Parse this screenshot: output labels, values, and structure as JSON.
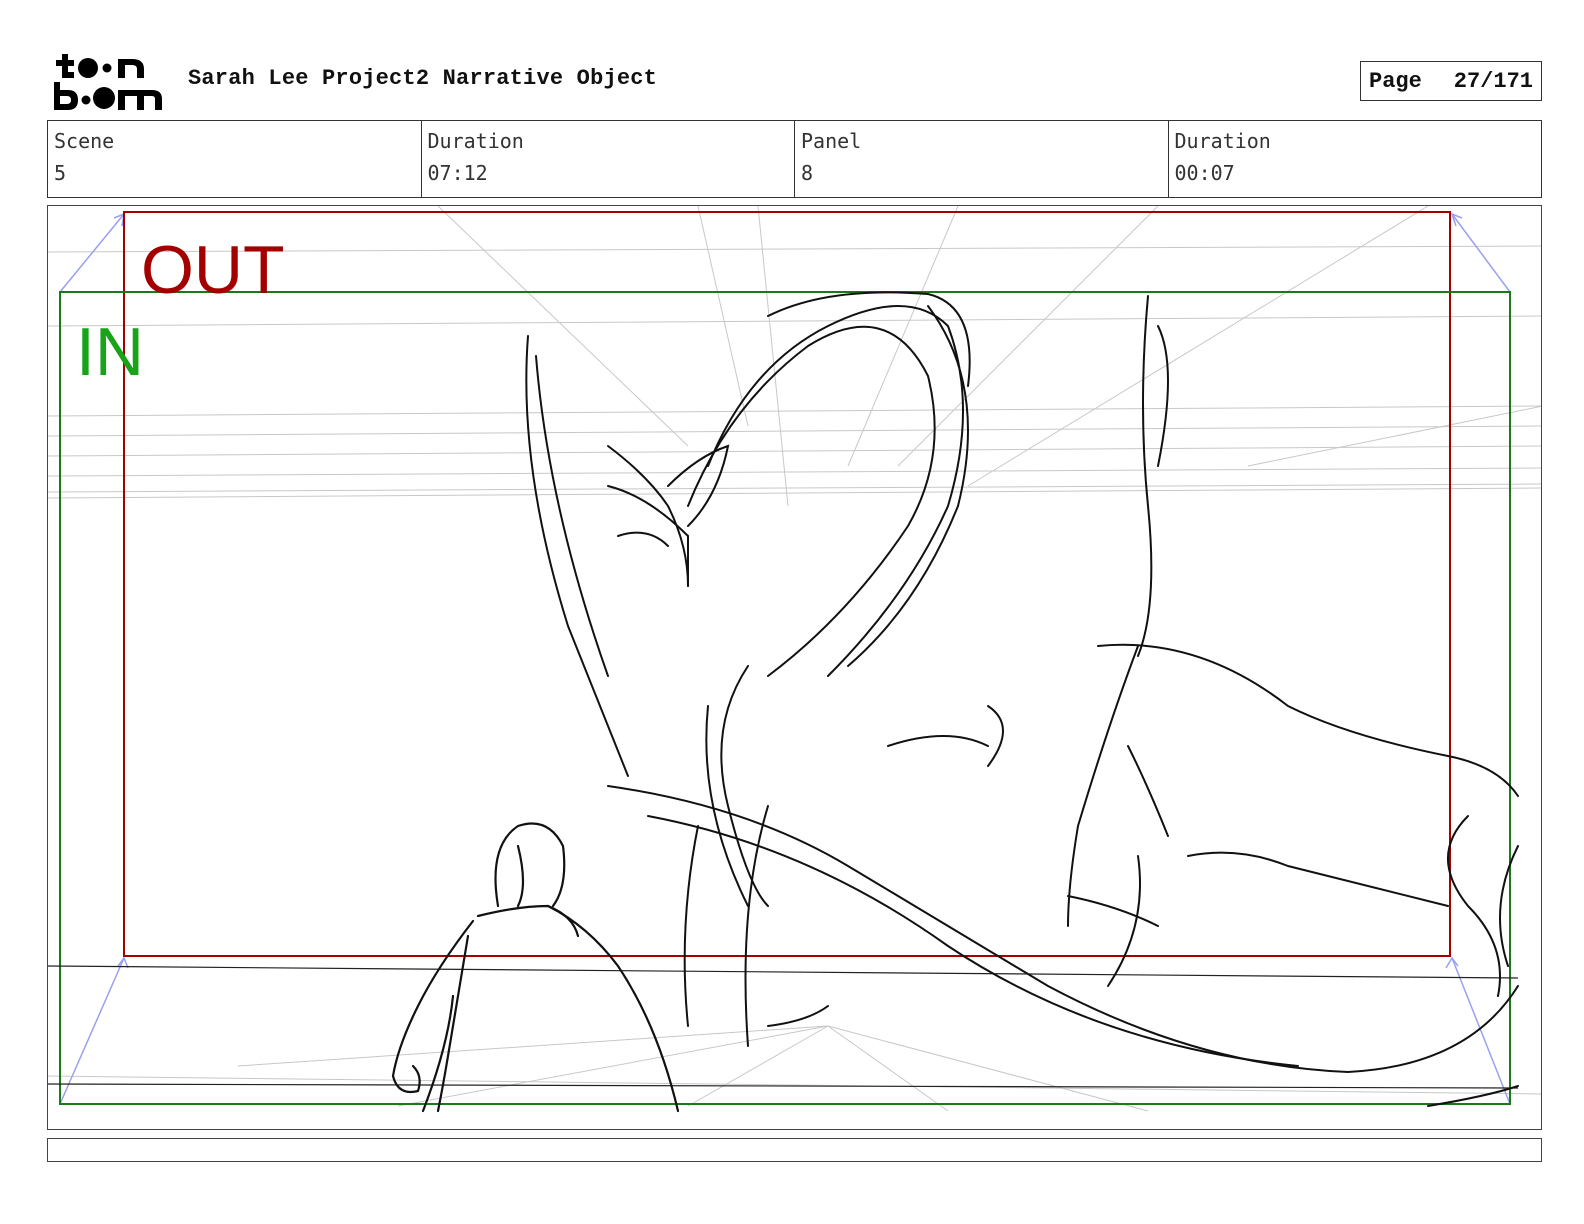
{
  "header": {
    "logo_text": "toon boom",
    "project_title": "Sarah Lee Project2 Narrative Object",
    "page_label": "Page",
    "page_number": "27/171"
  },
  "info": {
    "scene_label": "Scene",
    "scene_value": "5",
    "scene_duration_label": "Duration",
    "scene_duration_value": "07:12",
    "panel_label": "Panel",
    "panel_value": "8",
    "panel_duration_label": "Duration",
    "panel_duration_value": "00:07"
  },
  "panel": {
    "out_label": "OUT",
    "in_label": "IN",
    "out_frame_color": "#a40000",
    "in_frame_color": "#1a7a1a",
    "camera_arrow_color": "#9aa0f0"
  },
  "caption": {
    "text": ""
  }
}
